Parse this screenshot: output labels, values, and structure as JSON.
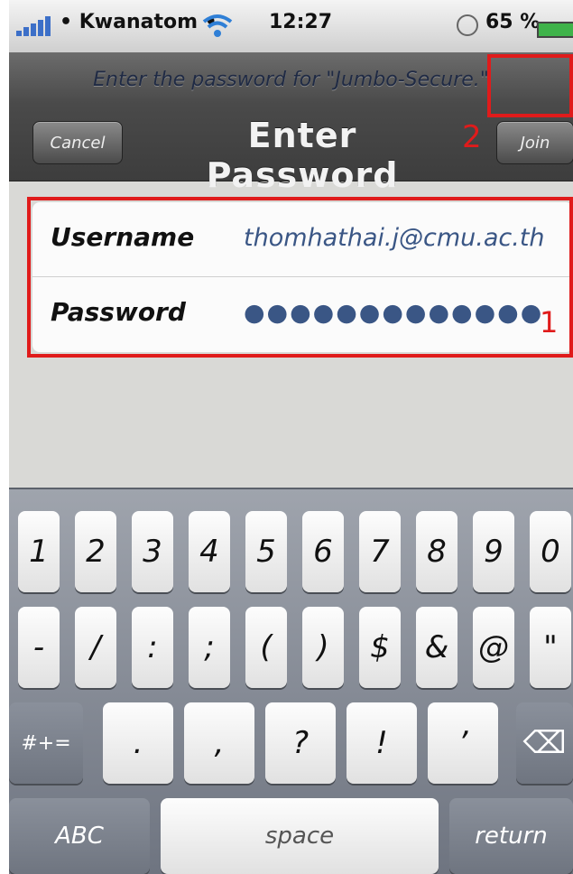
{
  "status_bar": {
    "carrier": "• Kwanatom •",
    "time": "12:27",
    "battery_percent": "65 %"
  },
  "nav": {
    "prompt": "Enter the password for \"Jumbo-Secure.\"",
    "title": "Enter Password",
    "cancel_label": "Cancel",
    "join_label": "Join"
  },
  "form": {
    "username_label": "Username",
    "username_value": "thomhathai.j@cmu.ac.th",
    "password_label": "Password",
    "password_value": "●●●●●●●●●●●●●"
  },
  "annotations": {
    "step1": "1",
    "step2": "2",
    "highlight_color": "#e01b1b"
  },
  "keyboard": {
    "row1": [
      "1",
      "2",
      "3",
      "4",
      "5",
      "6",
      "7",
      "8",
      "9",
      "0"
    ],
    "row2": [
      "-",
      "/",
      ":",
      ";",
      "(",
      ")",
      "$",
      "&",
      "@",
      "\""
    ],
    "row3": [
      "#+=",
      ".",
      ",",
      "?",
      "!",
      "’",
      "⌫"
    ],
    "row4": [
      "ABC",
      "space",
      "return"
    ]
  }
}
